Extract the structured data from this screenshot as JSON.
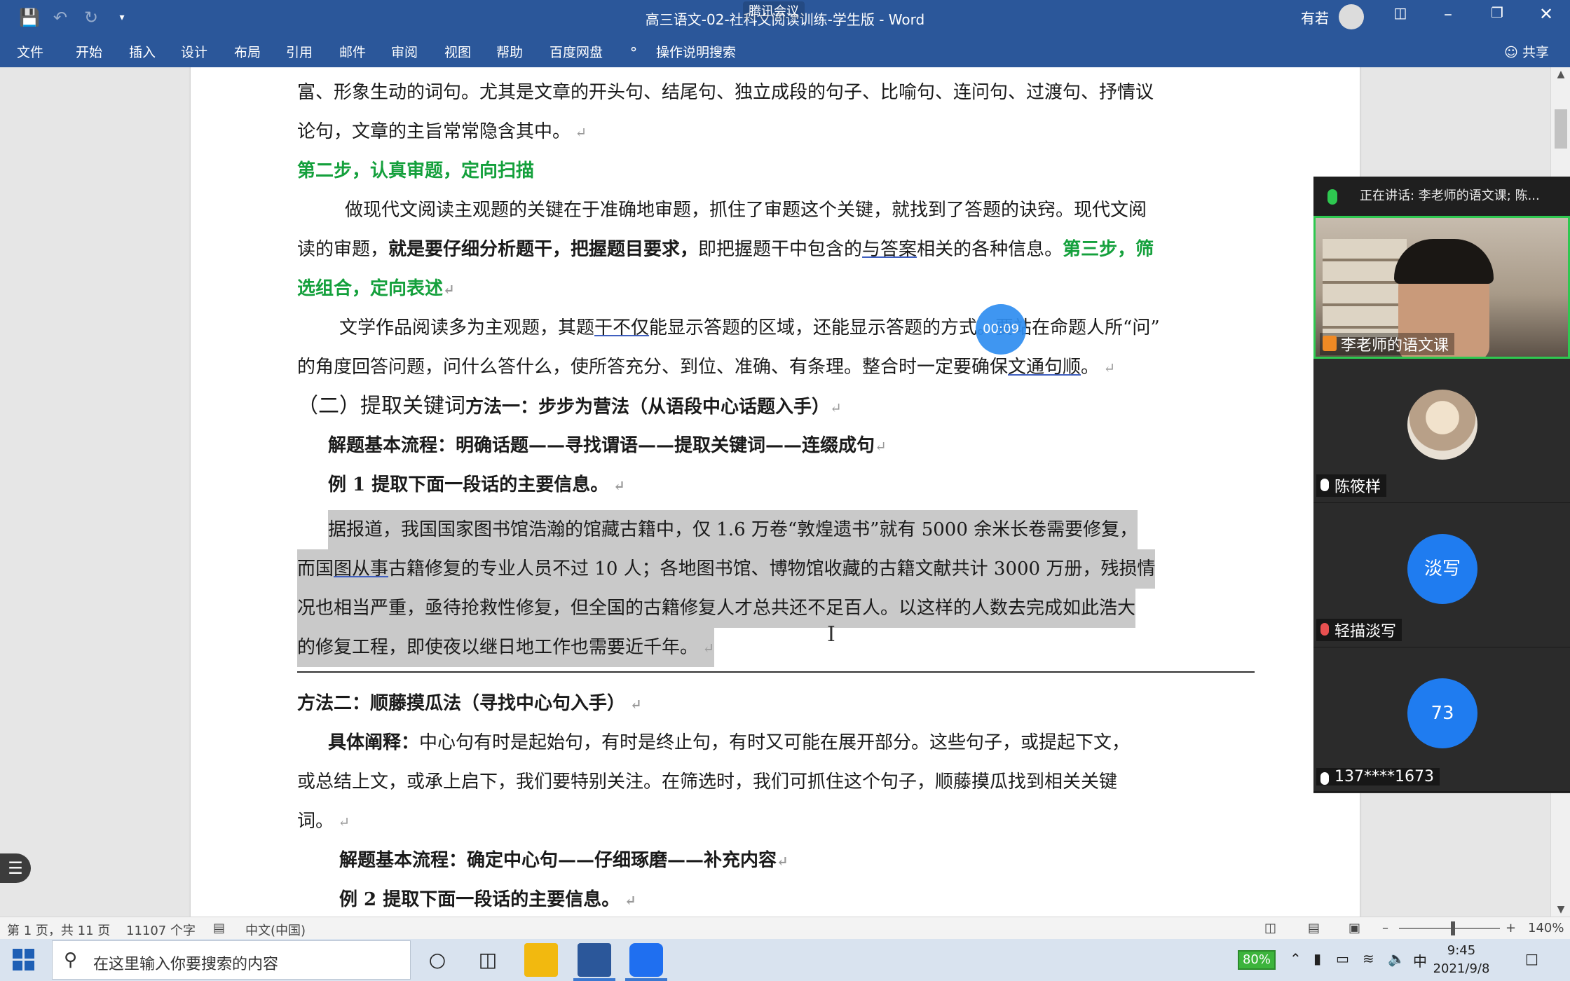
{
  "titlebar": {
    "doc_title": "高三语文-02-社科文阅读训练-学生版 - Word",
    "meeting_label": "腾讯会议",
    "user_name": "有若",
    "quick_access": [
      "save-icon",
      "undo-icon",
      "redo-icon",
      "customize-icon"
    ]
  },
  "ribbon": {
    "tabs": [
      "文件",
      "开始",
      "插入",
      "设计",
      "布局",
      "引用",
      "邮件",
      "审阅",
      "视图",
      "帮助",
      "百度网盘"
    ],
    "tell_me": "操作说明搜索",
    "share": "共享"
  },
  "doc": {
    "l1": "富、形象生动的词句。尤其是文章的开头句、结尾句、独立成段的句子、比喻句、连问句、过渡句、抒情议",
    "l2": "论句，文章的主旨常常隐含其中。",
    "l3": "第二步，认真审题，定向扫描",
    "l4": "做现代文阅读主观题的关键在于准确地审题，抓住了审题这个关键，就找到了答题的诀窍。现代文阅",
    "l5a": "读的审题，",
    "l5b": "就是要仔细分析题干，把握题目要求，",
    "l5c": "即把握题干中包含的",
    "l5d": "与答案",
    "l5e": "相关的各种信息。",
    "l5f": "第三步，筛",
    "l6": "选组合，定向表述",
    "l7a": "文学作品阅读多为主观题，其题",
    "l7b": "干不仅",
    "l7c": "能显示答题的区域，还能显示答题的方式。要站在命题人所“问”",
    "l8a": "的角度回答问题，问什么答什么，使所答充分、到位、准确、有条理。整合时一定要确保",
    "l8b": "文通句顺",
    "l8c": "。",
    "h1a": "（二）提取关键词",
    "h1b": "方法一：步步为营法（从语段中心话题入手）",
    "p1": "解题基本流程：明确话题——寻找谓语——提取关键词——连缀成句",
    "p2": "例 1 提取下面一段话的主要信息。",
    "q1": "据报道，我国国家图书馆浩瀚的馆藏古籍中，仅 1.6 万卷“敦煌遗书”就有 5000 余米长卷需要修复，",
    "q2a": "而国",
    "q2b": "图从事",
    "q2c": "古籍修复的专业人员不过 10 人；各地图书馆、博物馆收藏的古籍文献共计 3000 万册，残损情",
    "q3": "况也相当严重，亟待抢救性修复，但全国的古籍修复人才总共还不足百人。以这样的人数去完成如此浩大",
    "q4": "的修复工程，即使夜以继日地工作也需要近千年。",
    "m2": "方法二：顺藤摸瓜法（寻找中心句入手）",
    "m3a": "具体阐释：",
    "m3b": "中心句有时是起始句，有时是终止句，有时又可能在展开部分。这些句子，或提起下文，",
    "m4": "或总结上文，或承上启下，我们要特别关注。在筛选时，我们可抓住这个句子，顺藤摸瓜找到相关关键",
    "m5": "词。",
    "m6": "解题基本流程：确定中心句——仔细琢磨——补充内容",
    "m7": "例 2 提取下面一段话的主要信息。"
  },
  "timer": "00:09",
  "meeting": {
    "speaking": "正在讲话: 李老师的语文课; 陈...",
    "host_name": "李老师的语文课",
    "participants": [
      {
        "name": "陈筱样",
        "avatar": ""
      },
      {
        "name": "轻描淡写",
        "avatar": "淡写"
      },
      {
        "name": "137****1673",
        "avatar": "73"
      }
    ]
  },
  "statusbar": {
    "page": "第 1 页，共 11 页",
    "words": "11107 个字",
    "lang": "中文(中国)",
    "zoom": "140%"
  },
  "taskbar": {
    "search_placeholder": "在这里输入你要搜索的内容",
    "battery": "80%",
    "ime": "中",
    "time": "9:45",
    "date": "2021/9/8"
  },
  "colors": {
    "word_blue": "#2b579a",
    "green_heading": "#14a03c",
    "meeting_blue": "#1f7cf0"
  }
}
